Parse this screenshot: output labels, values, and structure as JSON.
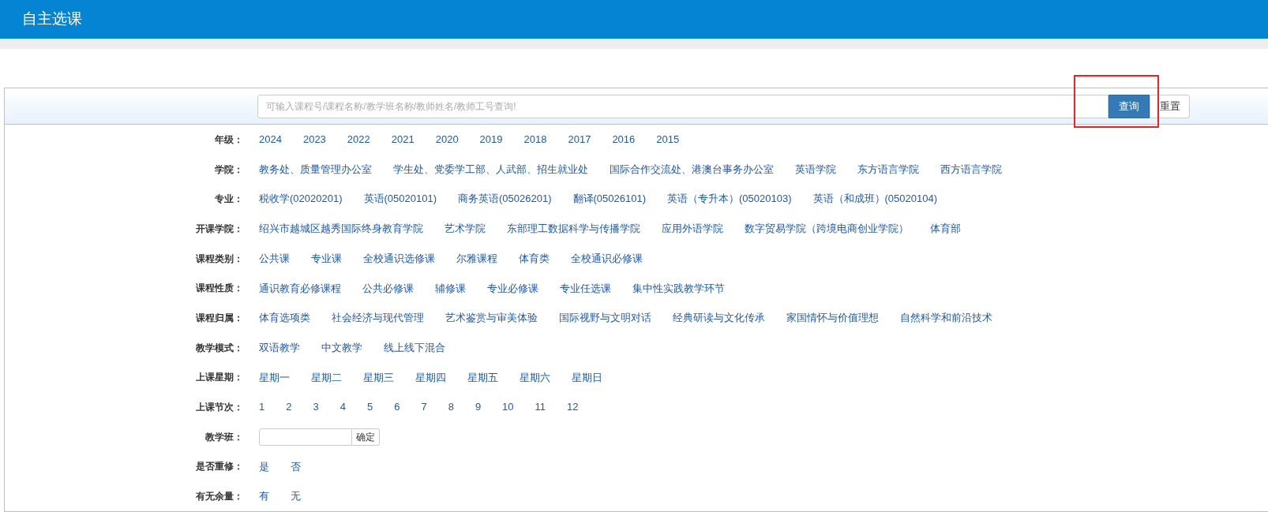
{
  "header": {
    "title": "自主选课"
  },
  "search": {
    "placeholder": "可输入课程号/课程名称/教学班名称/教师姓名/教师工号查询!",
    "query_button": {
      "label": "查询",
      "highlighted": true
    },
    "reset_button": {
      "label": "重置"
    }
  },
  "filters": [
    {
      "kind": "options",
      "label": "年级：",
      "options": [
        "2024",
        "2023",
        "2022",
        "2021",
        "2020",
        "2019",
        "2018",
        "2017",
        "2016",
        "2015"
      ]
    },
    {
      "kind": "options",
      "label": "学院：",
      "options": [
        "教务处、质量管理办公室",
        "学生处、党委学工部、人武部、招生就业处",
        "国际合作交流处、港澳台事务办公室",
        "英语学院",
        "东方语言学院",
        "西方语言学院"
      ]
    },
    {
      "kind": "options",
      "label": "专业：",
      "options": [
        "税收学(02020201)",
        "英语(05020101)",
        "商务英语(05026201)",
        "翻译(05026101)",
        "英语（专升本）(05020103)",
        "英语（和成班）(05020104)"
      ]
    },
    {
      "kind": "options",
      "label": "开课学院：",
      "options": [
        "绍兴市越城区越秀国际终身教育学院",
        "艺术学院",
        "东部理工数据科学与传播学院",
        "应用外语学院",
        "数字贸易学院（跨境电商创业学院）",
        "体育部"
      ]
    },
    {
      "kind": "options",
      "label": "课程类别：",
      "options": [
        "公共课",
        "专业课",
        "全校通识选修课",
        "尔雅课程",
        "体育类",
        "全校通识必修课"
      ]
    },
    {
      "kind": "options",
      "label": "课程性质：",
      "options": [
        "通识教育必修课程",
        "公共必修课",
        "辅修课",
        "专业必修课",
        "专业任选课",
        "集中性实践教学环节"
      ]
    },
    {
      "kind": "options",
      "label": "课程归属：",
      "options": [
        "体育选项类",
        "社会经济与现代管理",
        "艺术鉴赏与审美体验",
        "国际视野与文明对话",
        "经典研读与文化传承",
        "家国情怀与价值理想",
        "自然科学和前沿技术"
      ]
    },
    {
      "kind": "options",
      "label": "教学模式：",
      "options": [
        "双语教学",
        "中文教学",
        "线上线下混合"
      ]
    },
    {
      "kind": "options",
      "label": "上课星期：",
      "options": [
        "星期一",
        "星期二",
        "星期三",
        "星期四",
        "星期五",
        "星期六",
        "星期日"
      ]
    },
    {
      "kind": "options",
      "label": "上课节次：",
      "options": [
        "1",
        "2",
        "3",
        "4",
        "5",
        "6",
        "7",
        "8",
        "9",
        "10",
        "11",
        "12"
      ]
    },
    {
      "kind": "input",
      "label": "教学班：",
      "button": "确定"
    },
    {
      "kind": "options",
      "label": "是否重修：",
      "options": [
        "是",
        "否"
      ]
    },
    {
      "kind": "options",
      "label": "有无余量：",
      "options": [
        "有",
        "无"
      ]
    }
  ]
}
